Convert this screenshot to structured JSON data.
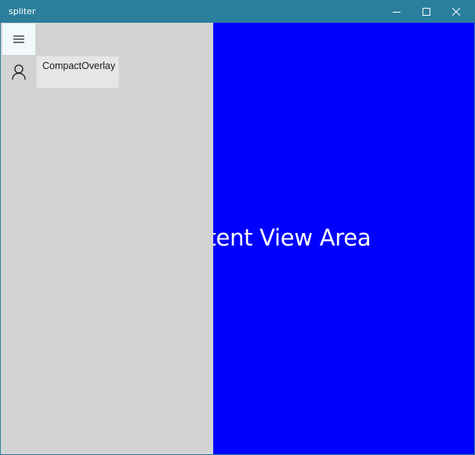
{
  "window": {
    "title": "spliter"
  },
  "title_bar_buttons": {
    "minimize_icon": "minimize-icon",
    "maximize_icon": "maximize-icon",
    "close_icon": "close-icon"
  },
  "navigation_pane": {
    "menu_icon": "hamburger-menu-icon",
    "items": [
      {
        "icon": "person-icon",
        "tooltip": "CompactOverlay"
      }
    ]
  },
  "content": {
    "text": "Content View Area"
  },
  "colors": {
    "titlebar": "#2b7f9c",
    "pane": "#d3d3d3",
    "content_background": "#0000ff",
    "tooltip_background": "#e6e6e6"
  }
}
